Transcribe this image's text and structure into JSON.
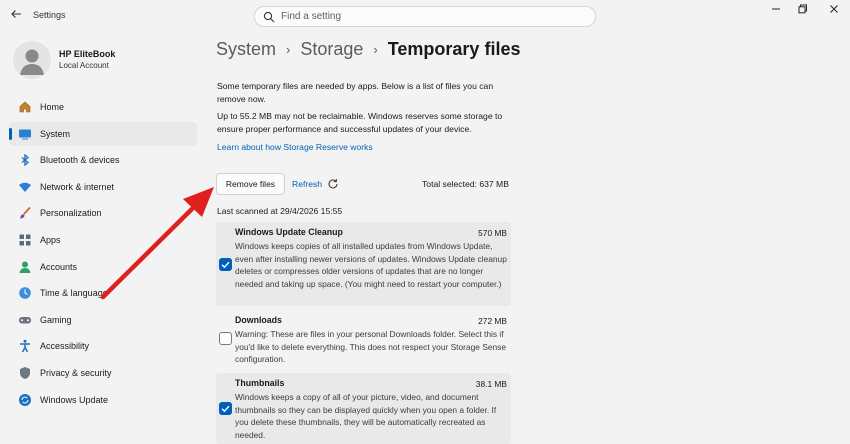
{
  "window": {
    "title": "Settings",
    "search_placeholder": "Find a setting",
    "controls": [
      "minimize-icon",
      "maximize-icon",
      "close-icon"
    ]
  },
  "profile": {
    "name": "HP EliteBook",
    "account_type": "Local Account"
  },
  "sidebar": {
    "items": [
      {
        "label": "Home",
        "icon": "home-icon",
        "selected": false
      },
      {
        "label": "System",
        "icon": "system-icon",
        "selected": true
      },
      {
        "label": "Bluetooth & devices",
        "icon": "bluetooth-icon",
        "selected": false
      },
      {
        "label": "Network & internet",
        "icon": "wifi-icon",
        "selected": false
      },
      {
        "label": "Personalization",
        "icon": "brush-icon",
        "selected": false
      },
      {
        "label": "Apps",
        "icon": "apps-icon",
        "selected": false
      },
      {
        "label": "Accounts",
        "icon": "accounts-icon",
        "selected": false
      },
      {
        "label": "Time & language",
        "icon": "globe-clock-icon",
        "selected": false
      },
      {
        "label": "Gaming",
        "icon": "gamepad-icon",
        "selected": false
      },
      {
        "label": "Accessibility",
        "icon": "accessibility-icon",
        "selected": false
      },
      {
        "label": "Privacy & security",
        "icon": "shield-icon",
        "selected": false
      },
      {
        "label": "Windows Update",
        "icon": "update-icon",
        "selected": false
      }
    ]
  },
  "breadcrumb": {
    "items": [
      "System",
      "Storage",
      "Temporary files"
    ],
    "separator": "›"
  },
  "content": {
    "intro": "Some temporary files are needed by apps. Below is a list of files you can remove now.",
    "reserve_note": "Up to 55.2 MB may not be reclaimable. Windows reserves some storage to ensure proper performance and successful updates of your device.",
    "learn_link": "Learn about how Storage Reserve works",
    "remove_button": "Remove files",
    "refresh_label": "Refresh",
    "total_selected": "Total selected: 637 MB",
    "last_scanned": "Last scanned at 29/4/2026 15:55",
    "files": [
      {
        "title": "Windows Update Cleanup",
        "size": "570 MB",
        "checked": true,
        "description": "Windows keeps copies of all installed updates from Windows Update, even after installing newer versions of updates. Windows Update cleanup deletes or compresses older versions of updates that are no longer needed and taking up space. (You might need to restart your computer.)"
      },
      {
        "title": "Downloads",
        "size": "272 MB",
        "checked": false,
        "description": "Warning: These are files in your personal Downloads folder. Select this if you'd like to delete everything. This does not respect your Storage Sense configuration."
      },
      {
        "title": "Thumbnails",
        "size": "38.1 MB",
        "checked": true,
        "description": "Windows keeps a copy of all of your picture, video, and document thumbnails so they can be displayed quickly when you open a folder. If you delete these thumbnails, they will be automatically recreated as needed."
      }
    ]
  },
  "colors": {
    "accent": "#005fb8",
    "annotation_arrow": "#e02020",
    "background": "#f3f3f3"
  }
}
